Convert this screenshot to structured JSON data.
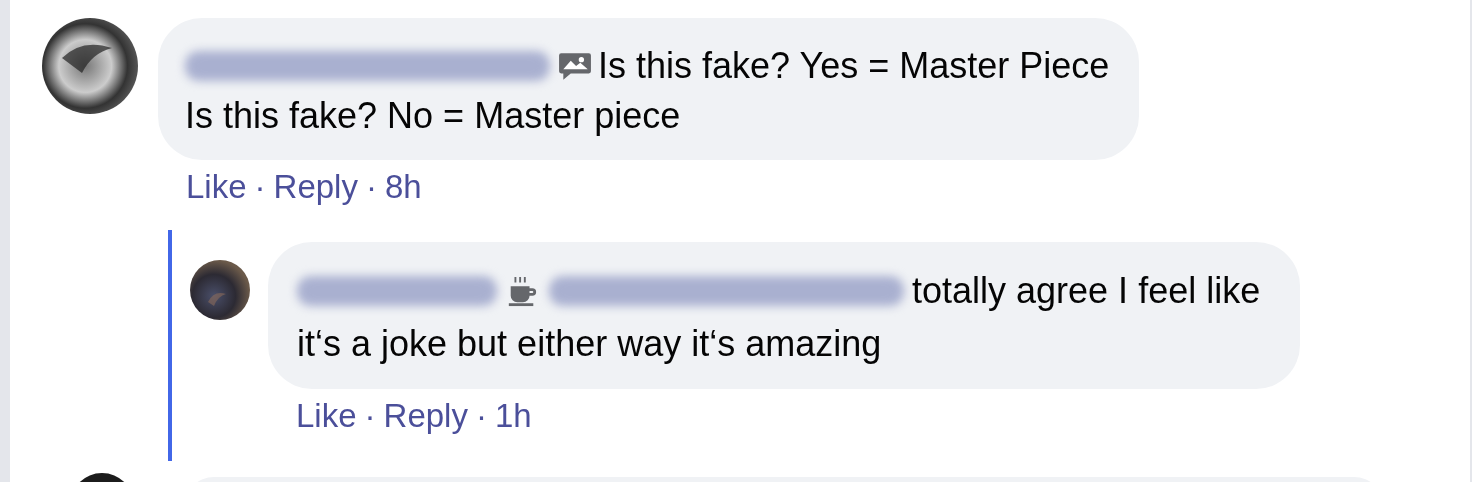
{
  "comments": [
    {
      "lines": [
        "Is this fake? Yes = Master Piece",
        "Is this fake? No = Master piece"
      ],
      "meta": [
        {
          "kind": "link",
          "text": "Like"
        },
        {
          "kind": "separator",
          "text": "·"
        },
        {
          "kind": "link",
          "text": "Reply"
        },
        {
          "kind": "separator",
          "text": "·"
        },
        {
          "kind": "time",
          "text": "8h"
        }
      ],
      "replies": [
        {
          "lines": [
            "totally agree I feel like",
            "it‘s a joke but either way it‘s amazing"
          ],
          "meta": [
            {
              "kind": "link",
              "text": "Like"
            },
            {
              "kind": "separator",
              "text": "·"
            },
            {
              "kind": "link",
              "text": "Reply"
            },
            {
              "kind": "separator",
              "text": "·"
            },
            {
              "kind": "time",
              "text": "1h"
            }
          ]
        }
      ]
    }
  ]
}
